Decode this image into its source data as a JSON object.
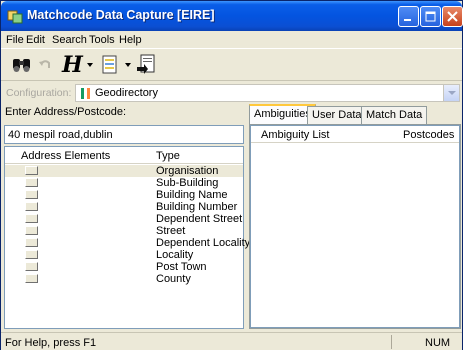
{
  "window": {
    "title": "Matchcode Data Capture [EIRE]"
  },
  "menu": {
    "file": "File",
    "edit": "Edit",
    "search": "Search",
    "tools": "Tools",
    "help": "Help"
  },
  "config": {
    "label": "Configuration:",
    "value": "Geodirectory"
  },
  "left": {
    "label": "Enter Address/Postcode:",
    "input_value": "40 mespil road,dublin",
    "col_elements": "Address Elements",
    "col_type": "Type",
    "rows": [
      "Organisation",
      "Sub-Building",
      "Building Name",
      "Building Number",
      "Dependent Street",
      "Street",
      "Dependent Locality",
      "Locality",
      "Post Town",
      "County"
    ]
  },
  "right": {
    "tabs": [
      "Ambiguities",
      "User Data",
      "Match Data"
    ],
    "col_list": "Ambiguity List",
    "col_postcodes": "Postcodes"
  },
  "status": {
    "help": "For Help, press F1",
    "num": "NUM"
  },
  "colors": {
    "titlebar": "#0454e0",
    "face": "#ece9d8",
    "flag_green": "#169b62",
    "flag_white": "#ffffff",
    "flag_orange": "#ff883e"
  },
  "icons": [
    "app-icon",
    "binoculars-icon",
    "undo-icon",
    "header-h-icon",
    "record-icon",
    "export-icon",
    "minimize-icon",
    "maximize-icon",
    "close-icon"
  ]
}
